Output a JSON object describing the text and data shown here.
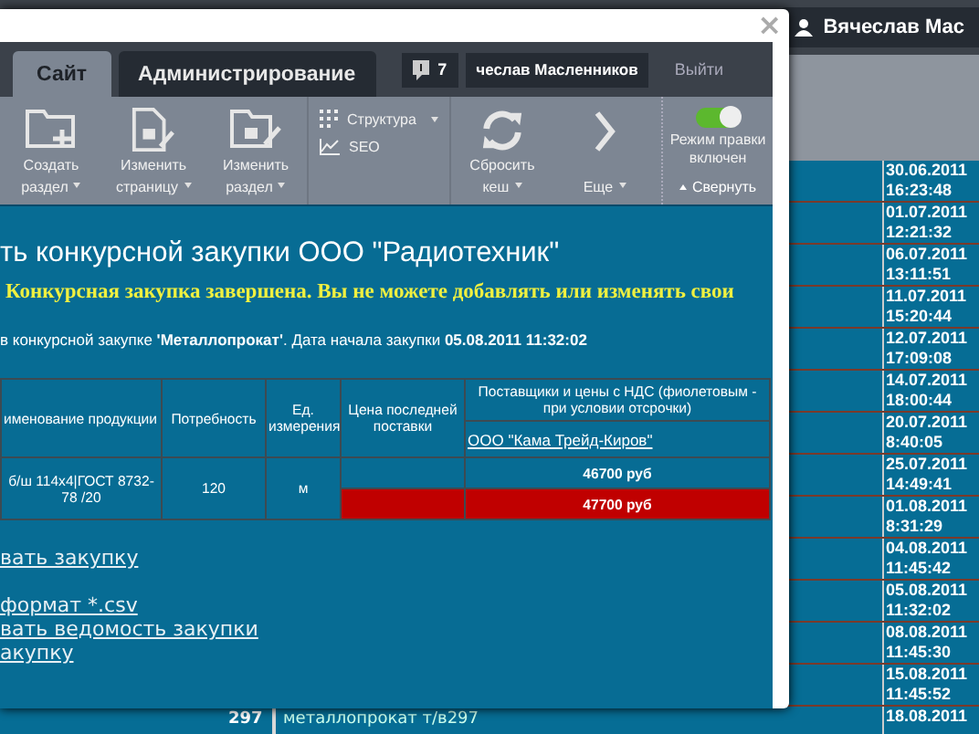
{
  "page": {
    "user": "Вячеслав Мас",
    "dates": [
      {
        "date": "30.06.2011",
        "time": "16:23:48"
      },
      {
        "date": "01.07.2011",
        "time": "12:21:32"
      },
      {
        "date": "06.07.2011",
        "time": "13:11:51"
      },
      {
        "date": "11.07.2011",
        "time": "15:20:44"
      },
      {
        "date": "12.07.2011",
        "time": "17:09:08"
      },
      {
        "date": "14.07.2011",
        "time": "18:00:44"
      },
      {
        "date": "20.07.2011",
        "time": "8:40:05"
      },
      {
        "date": "25.07.2011",
        "time": "14:49:41"
      },
      {
        "date": "01.08.2011",
        "time": "8:31:29"
      },
      {
        "date": "04.08.2011",
        "time": "11:45:42"
      },
      {
        "date": "05.08.2011",
        "time": "11:32:02"
      },
      {
        "date": "08.08.2011",
        "time": "11:45:30"
      },
      {
        "date": "15.08.2011",
        "time": "11:45:52"
      }
    ],
    "last_row": {
      "number": "297",
      "name": "металлопрокат т/в297",
      "date": "18.08.2011"
    }
  },
  "dialog": {
    "close": "×"
  },
  "admin_panel": {
    "tabs": [
      {
        "label": "Сайт",
        "selected": true
      },
      {
        "label": "Администрирование",
        "selected": false
      }
    ],
    "notifications": "7",
    "user": "чеслав Масленников",
    "logout": "Выйти",
    "toolbar": [
      {
        "kind": "button",
        "label": "Создать раздел"
      },
      {
        "kind": "button",
        "label": "Изменить страницу"
      },
      {
        "kind": "button",
        "label": "Изменить раздел"
      },
      {
        "kind": "menu",
        "items": [
          {
            "label": "Структура",
            "dropdown": true
          },
          {
            "label": "SEO",
            "dropdown": false
          }
        ]
      },
      {
        "kind": "button",
        "label": "Сбросить кеш"
      },
      {
        "kind": "button",
        "label": "Еще"
      }
    ],
    "edit_mode": {
      "label": "Режим правки включен",
      "on": true
    },
    "collapse": "Свернуть"
  },
  "content": {
    "title": "ть конкурсной закупки ООО \"Радиотехник\"",
    "notice": "Конкурсная закупка завершена. Вы не можете добавлять или изменять свои",
    "info": "в конкурсной закупке **'Металлопрокат'**. Дата начала закупки **05.08.2011 11:32:02**",
    "table": {
      "columns": [
        "именование продукции",
        "Потребность",
        "Ед. измерения",
        "Цена последней поставки",
        "Поставщики и цены с НДС (фиолетовым - при условии отсрочки)"
      ],
      "supplier": "ООО \"Кама Трейд-Киров\"",
      "row": {
        "product": "б/ш 114х4|ГОСТ 8732-78 /20",
        "need": "120",
        "unit": "м"
      },
      "prices": [
        {
          "supplier_price": "46700 руб",
          "highlighted": false
        },
        {
          "supplier_price": "47700 руб",
          "highlighted": true
        }
      ]
    },
    "link_groups": [
      {
        "links": [
          "вать закупку"
        ]
      },
      {
        "links": [
          "формат *.csv",
          "вать ведомость закупки",
          "акупку"
        ]
      }
    ]
  }
}
